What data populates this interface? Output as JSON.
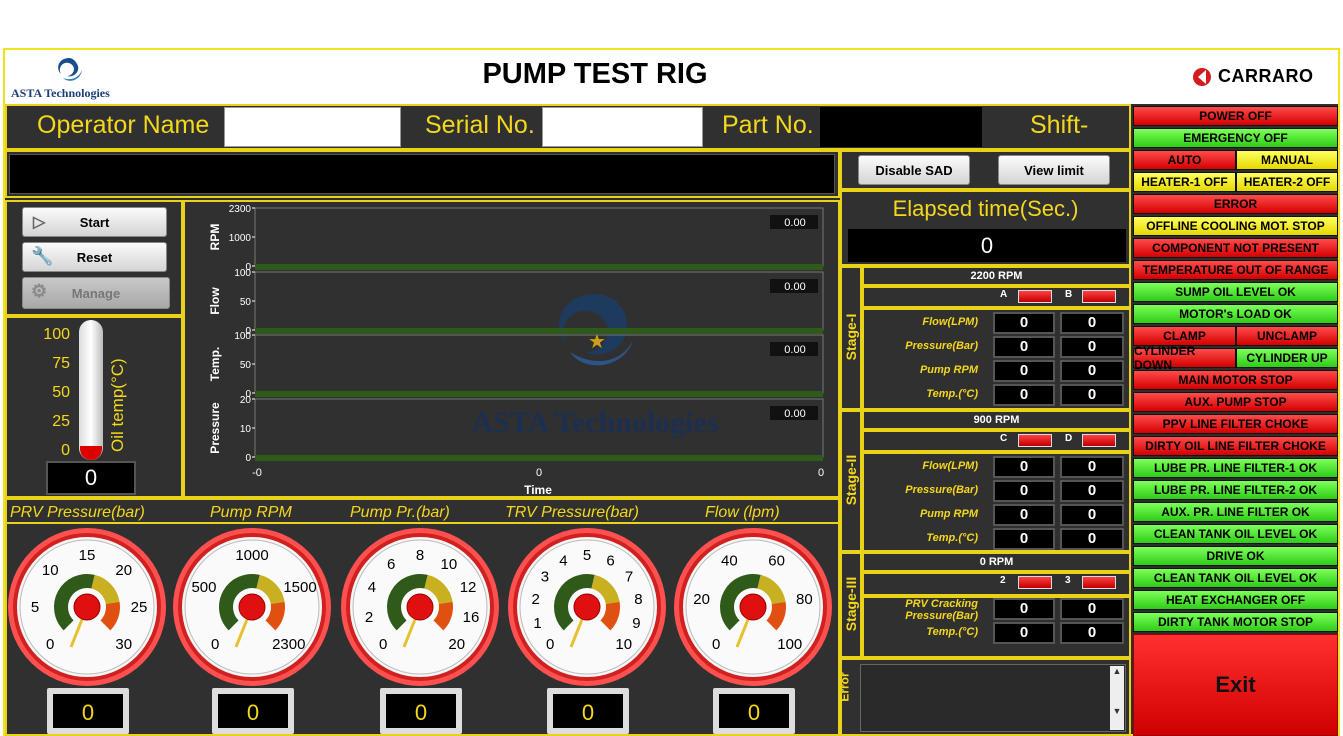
{
  "header": {
    "title": "PUMP TEST RIG",
    "logo_left": "ASTA Technologies",
    "logo_right": "CARRARO"
  },
  "fields": {
    "operator_label": "Operator Name",
    "serial_label": "Serial No.",
    "part_label": "Part No.",
    "shift_label": "Shift-",
    "operator_value": "",
    "serial_value": "",
    "part_value": ""
  },
  "buttons": {
    "disable_sad": "Disable SAD",
    "view_limit": "View limit",
    "start": "Start",
    "reset": "Reset",
    "manage": "Manage",
    "exit": "Exit"
  },
  "thermometer": {
    "label": "Oil temp(°C)",
    "ticks": [
      "100",
      "75",
      "50",
      "25",
      "0"
    ],
    "value": "0"
  },
  "chart": {
    "xlabel": "Time",
    "x_ticks": [
      "-0",
      "0",
      "0"
    ],
    "panels": [
      {
        "label": "RPM",
        "ticks": [
          "2300",
          "1000",
          "0"
        ],
        "readout": "0.00"
      },
      {
        "label": "Flow",
        "ticks": [
          "100",
          "50",
          "0"
        ],
        "readout": "0.00"
      },
      {
        "label": "Temp.",
        "ticks": [
          "100",
          "50",
          "0"
        ],
        "readout": "0.00"
      },
      {
        "label": "Pressure",
        "ticks": [
          "20",
          "10",
          "0"
        ],
        "readout": "0.00"
      }
    ],
    "watermark": "ASTA Technologies"
  },
  "gauges": [
    {
      "label": "PRV Pressure(bar)",
      "ticks": [
        "0",
        "5",
        "10",
        "15",
        "20",
        "25",
        "30"
      ],
      "value": "0"
    },
    {
      "label": "Pump RPM",
      "ticks": [
        "0",
        "500",
        "1000",
        "1500",
        "2300"
      ],
      "value": "0"
    },
    {
      "label": "Pump Pr.(bar)",
      "ticks": [
        "0",
        "2",
        "4",
        "6",
        "8",
        "10",
        "12",
        "16",
        "20"
      ],
      "value": "0"
    },
    {
      "label": "TRV Pressure(bar)",
      "ticks": [
        "0",
        "1",
        "2",
        "3",
        "4",
        "5",
        "6",
        "7",
        "8",
        "9",
        "10"
      ],
      "value": "0"
    },
    {
      "label": "Flow (lpm)",
      "ticks": [
        "0",
        "20",
        "40",
        "60",
        "80",
        "100"
      ],
      "value": "0"
    }
  ],
  "elapsed": {
    "label": "Elapsed time(Sec.)",
    "value": "0"
  },
  "stage1": {
    "title": "Stage-I",
    "rpm": "2200 RPM",
    "chA": "A",
    "chB": "B",
    "rows": [
      {
        "label": "Flow(LPM)",
        "a": "0",
        "b": "0"
      },
      {
        "label": "Pressure(Bar)",
        "a": "0",
        "b": "0"
      },
      {
        "label": "Pump RPM",
        "a": "0",
        "b": "0"
      },
      {
        "label": "Temp.(°C)",
        "a": "0",
        "b": "0"
      }
    ]
  },
  "stage2": {
    "title": "Stage-II",
    "rpm": "900 RPM",
    "chA": "C",
    "chB": "D",
    "rows": [
      {
        "label": "Flow(LPM)",
        "a": "0",
        "b": "0"
      },
      {
        "label": "Pressure(Bar)",
        "a": "0",
        "b": "0"
      },
      {
        "label": "Pump RPM",
        "a": "0",
        "b": "0"
      },
      {
        "label": "Temp.(°C)",
        "a": "0",
        "b": "0"
      }
    ]
  },
  "stage3": {
    "title": "Stage-III",
    "rpm": "0 RPM",
    "chA": "2",
    "chB": "3",
    "rows": [
      {
        "label": "PRV Cracking Pressure(Bar)",
        "a": "0",
        "b": "0"
      },
      {
        "label": "Temp.(°C)",
        "a": "0",
        "b": "0"
      }
    ]
  },
  "error_label": "Error",
  "status": {
    "colors": {
      "red": "#e01010",
      "green": "#3fd020",
      "yellow": "#f0e000"
    },
    "rows": [
      {
        "type": "single",
        "text": "POWER OFF",
        "color": "red"
      },
      {
        "type": "single",
        "text": "EMERGENCY OFF",
        "color": "green"
      },
      {
        "type": "pair",
        "left": "AUTO",
        "lcolor": "red",
        "right": "MANUAL",
        "rcolor": "yellow"
      },
      {
        "type": "pair",
        "left": "HEATER-1 OFF",
        "lcolor": "yellow",
        "right": "HEATER-2 OFF",
        "rcolor": "yellow"
      },
      {
        "type": "single",
        "text": "ERROR",
        "color": "red"
      },
      {
        "type": "single",
        "text": "OFFLINE COOLING MOT. STOP",
        "color": "yellow"
      },
      {
        "type": "single",
        "text": "COMPONENT NOT PRESENT",
        "color": "red"
      },
      {
        "type": "single",
        "text": "TEMPERATURE OUT OF RANGE",
        "color": "red"
      },
      {
        "type": "single",
        "text": "SUMP OIL LEVEL OK",
        "color": "green"
      },
      {
        "type": "single",
        "text": "MOTOR's LOAD OK",
        "color": "green"
      },
      {
        "type": "pair",
        "left": "CLAMP",
        "lcolor": "red",
        "right": "UNCLAMP",
        "rcolor": "red"
      },
      {
        "type": "pair",
        "left": "CYLINDER DOWN",
        "lcolor": "red",
        "right": "CYLINDER UP",
        "rcolor": "green"
      },
      {
        "type": "single",
        "text": "MAIN MOTOR STOP",
        "color": "red"
      },
      {
        "type": "single",
        "text": "AUX. PUMP STOP",
        "color": "red"
      },
      {
        "type": "single",
        "text": "PPV LINE FILTER CHOKE",
        "color": "red"
      },
      {
        "type": "single",
        "text": "DIRTY OIL LINE FILTER CHOKE",
        "color": "red"
      },
      {
        "type": "single",
        "text": "LUBE PR. LINE FILTER-1 OK",
        "color": "green"
      },
      {
        "type": "single",
        "text": "LUBE PR. LINE FILTER-2 OK",
        "color": "green"
      },
      {
        "type": "single",
        "text": "AUX. PR. LINE FILTER OK",
        "color": "green"
      },
      {
        "type": "single",
        "text": "CLEAN TANK OIL LEVEL OK",
        "color": "green"
      },
      {
        "type": "single",
        "text": "DRIVE OK",
        "color": "green"
      },
      {
        "type": "single",
        "text": "CLEAN TANK OIL LEVEL OK",
        "color": "green"
      },
      {
        "type": "single",
        "text": "HEAT EXCHANGER OFF",
        "color": "green"
      },
      {
        "type": "single",
        "text": "DIRTY TANK MOTOR STOP",
        "color": "green"
      }
    ]
  }
}
